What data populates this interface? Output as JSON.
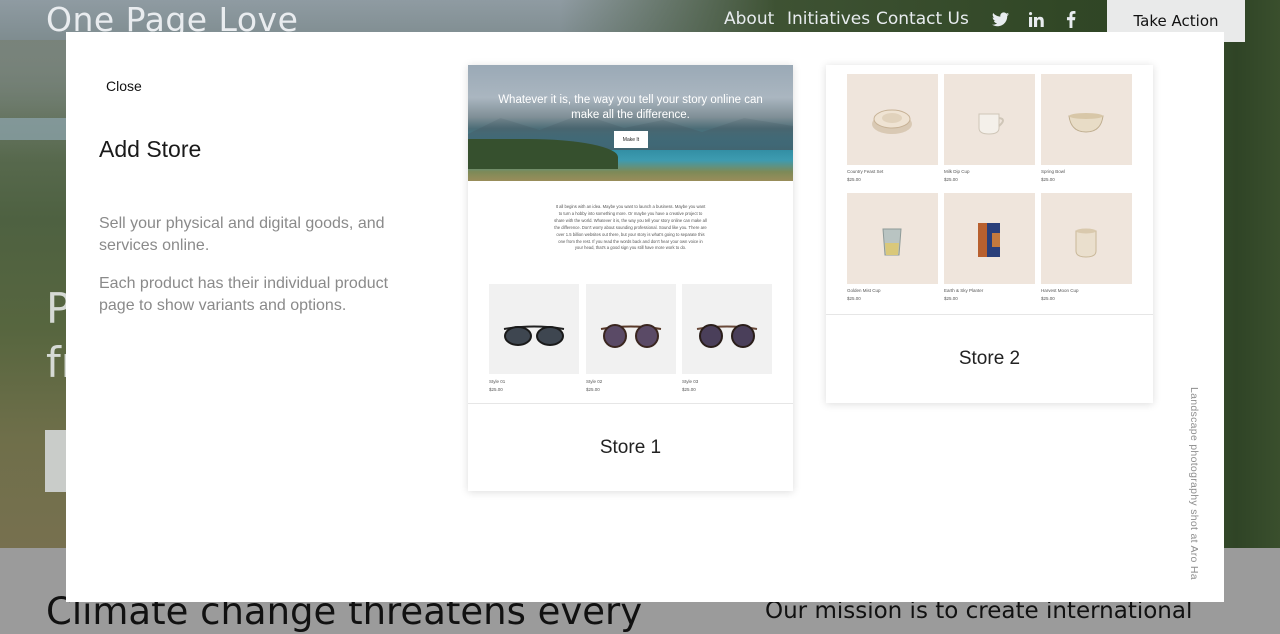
{
  "site": {
    "logo": "One Page Love",
    "nav": [
      "About",
      "Initiatives",
      "Contact Us"
    ],
    "social_icons": [
      "twitter-icon",
      "linkedin-icon",
      "facebook-icon"
    ],
    "take_action": "Take Action",
    "hero_partial": "P\nfr",
    "climate_heading": "Climate change threatens every",
    "mission_text": "Our mission is to create international"
  },
  "modal": {
    "close": "Close",
    "title": "Add Store",
    "description_1": "Sell your physical and digital goods, and services online.",
    "description_2": "Each product has their individual product page to show variants and options.",
    "photo_credit": "Landscape photography shot at Aro Ha",
    "stores": [
      {
        "label": "Store 1",
        "headline": "Whatever it is, the way you tell your story online can make all the difference.",
        "button": "Make It",
        "paragraph": "It all begins with an idea. Maybe you want to launch a business. Maybe you want to turn a hobby into something more. Or maybe you have a creative project to share with the world. Whatever it is, the way you tell your story online can make all the difference. Don't worry about sounding professional. Sound like you. There are over 1.5 billion websites out there, but your story is what's going to separate this one from the rest. If you read the words back and don't hear your own voice in your head, that's a good sign you still have more work to do.",
        "products": [
          {
            "name": "Style 01",
            "price": "$25.00"
          },
          {
            "name": "Style 02",
            "price": "$25.00"
          },
          {
            "name": "Style 03",
            "price": "$25.00"
          }
        ]
      },
      {
        "label": "Store 2",
        "products": [
          {
            "name": "Country Feast Set",
            "price": "$25.00"
          },
          {
            "name": "Milk Dip Cup",
            "price": "$25.00"
          },
          {
            "name": "Spring Bowl",
            "price": "$25.00"
          },
          {
            "name": "Golden Mist Cup",
            "price": "$25.00"
          },
          {
            "name": "Earth & Sky Planter",
            "price": "$25.00"
          },
          {
            "name": "Harvest Moon Cup",
            "price": "$25.00"
          }
        ]
      }
    ]
  },
  "colors": {
    "modal_bg": "#ffffff",
    "muted_text": "#8a8a8a",
    "ceramic_bg": "#efe5dc",
    "take_action_bg": "#e9eaea"
  }
}
